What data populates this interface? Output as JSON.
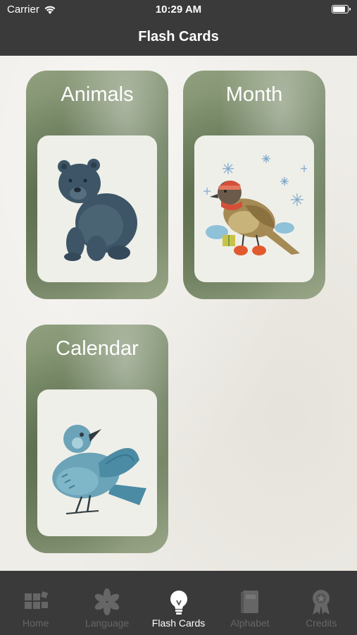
{
  "status_bar": {
    "carrier": "Carrier",
    "time": "10:29 AM",
    "battery_level": 0.9
  },
  "nav": {
    "title": "Flash Cards"
  },
  "cards": [
    {
      "title": "Animals",
      "illustration": "bear-illustration"
    },
    {
      "title": "Month",
      "illustration": "winter-bird-illustration"
    },
    {
      "title": "Calendar",
      "illustration": "blue-bird-illustration"
    }
  ],
  "tabs": [
    {
      "label": "Home",
      "icon": "blocks-icon",
      "active": false
    },
    {
      "label": "Language",
      "icon": "asterisk-icon",
      "active": false
    },
    {
      "label": "Flash Cards",
      "icon": "lightbulb-icon",
      "active": true
    },
    {
      "label": "Alphabet",
      "icon": "book-icon",
      "active": false
    },
    {
      "label": "Credits",
      "icon": "ribbon-icon",
      "active": false
    }
  ],
  "colors": {
    "bar": "#3a3a3a",
    "card_green": "#6e8060",
    "tab_inactive": "#666666",
    "tab_active": "#ffffff"
  }
}
